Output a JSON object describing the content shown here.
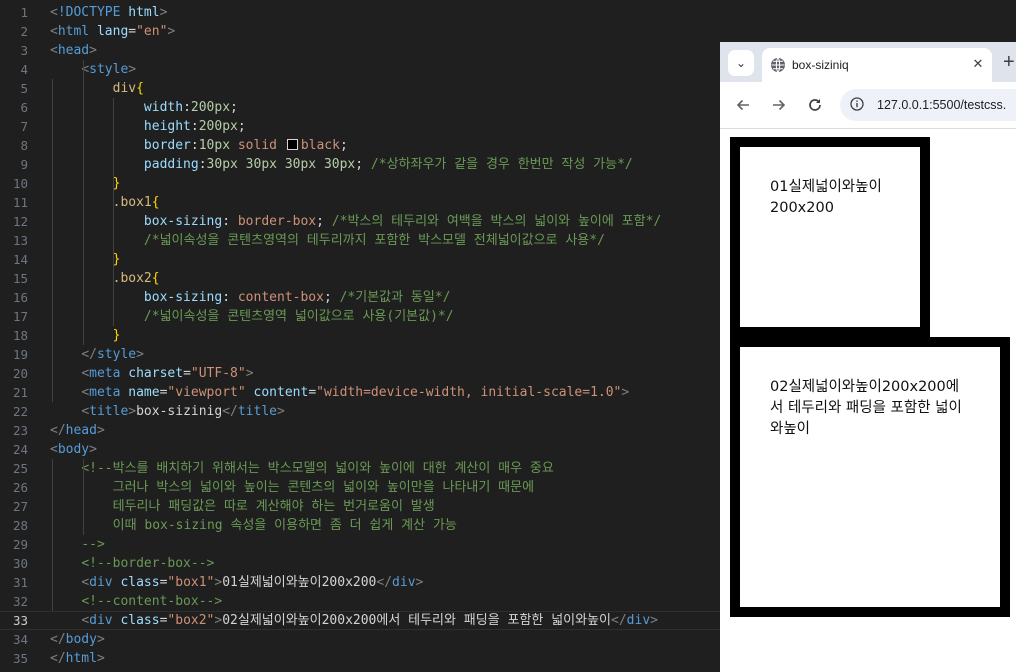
{
  "editor": {
    "lines": [
      {
        "n": "1",
        "segs": [
          [
            "t-tag",
            "<"
          ],
          [
            "t-dt",
            "!DOCTYPE "
          ],
          [
            "t-an",
            "html"
          ],
          [
            "t-tag",
            ">"
          ]
        ]
      },
      {
        "n": "2",
        "segs": [
          [
            "t-tag",
            "<"
          ],
          [
            "t-tn",
            "html "
          ],
          [
            "t-an",
            "lang"
          ],
          [
            "t-txt",
            "="
          ],
          [
            "t-av",
            "\"en\""
          ],
          [
            "t-tag",
            ">"
          ]
        ]
      },
      {
        "n": "3",
        "segs": [
          [
            "t-tag",
            "<"
          ],
          [
            "t-tn",
            "head"
          ],
          [
            "t-tag",
            ">"
          ]
        ]
      },
      {
        "n": "4",
        "segs": [
          [
            "t-txt",
            "    "
          ],
          [
            "t-tag",
            "<"
          ],
          [
            "t-tn",
            "style"
          ],
          [
            "t-tag",
            ">"
          ]
        ]
      },
      {
        "n": "5",
        "segs": [
          [
            "t-txt",
            "        "
          ],
          [
            "t-sel",
            "div"
          ],
          [
            "t-brace",
            "{"
          ]
        ]
      },
      {
        "n": "6",
        "segs": [
          [
            "t-txt",
            "            "
          ],
          [
            "t-prop",
            "width"
          ],
          [
            "t-txt",
            ":"
          ],
          [
            "t-num",
            "200px"
          ],
          [
            "t-txt",
            ";"
          ]
        ]
      },
      {
        "n": "7",
        "segs": [
          [
            "t-txt",
            "            "
          ],
          [
            "t-prop",
            "height"
          ],
          [
            "t-txt",
            ":"
          ],
          [
            "t-num",
            "200px"
          ],
          [
            "t-txt",
            ";"
          ]
        ]
      },
      {
        "n": "8",
        "segs": [
          [
            "t-txt",
            "            "
          ],
          [
            "t-prop",
            "border"
          ],
          [
            "t-txt",
            ":"
          ],
          [
            "t-num",
            "10px "
          ],
          [
            "t-val",
            "solid "
          ],
          [
            "swatch",
            ""
          ],
          [
            "t-val",
            "black"
          ],
          [
            "t-txt",
            ";"
          ]
        ]
      },
      {
        "n": "9",
        "segs": [
          [
            "t-txt",
            "            "
          ],
          [
            "t-prop",
            "padding"
          ],
          [
            "t-txt",
            ":"
          ],
          [
            "t-num",
            "30px 30px 30px 30px"
          ],
          [
            "t-txt",
            "; "
          ],
          [
            "t-com",
            "/*상하좌우가 같을 경우 한번만 작성 가능*/"
          ]
        ]
      },
      {
        "n": "10",
        "segs": [
          [
            "t-txt",
            "        "
          ],
          [
            "t-brace",
            "}"
          ]
        ]
      },
      {
        "n": "11",
        "segs": [
          [
            "t-txt",
            "        "
          ],
          [
            "t-sel",
            ".box1"
          ],
          [
            "t-brace",
            "{"
          ]
        ]
      },
      {
        "n": "12",
        "segs": [
          [
            "t-txt",
            "            "
          ],
          [
            "t-prop",
            "box-sizing"
          ],
          [
            "t-txt",
            ": "
          ],
          [
            "t-val",
            "border-box"
          ],
          [
            "t-txt",
            "; "
          ],
          [
            "t-com",
            "/*박스의 테두리와 여백을 박스의 넓이와 높이에 포함*/"
          ]
        ]
      },
      {
        "n": "13",
        "segs": [
          [
            "t-txt",
            "            "
          ],
          [
            "t-com",
            "/*넓이속성을 콘텐츠영역의 테두리까지 포함한 박스모델 전체넓이값으로 사용*/"
          ]
        ]
      },
      {
        "n": "14",
        "segs": [
          [
            "t-txt",
            "        "
          ],
          [
            "t-brace",
            "}"
          ]
        ]
      },
      {
        "n": "15",
        "segs": [
          [
            "t-txt",
            "        "
          ],
          [
            "t-sel",
            ".box2"
          ],
          [
            "t-brace",
            "{"
          ]
        ]
      },
      {
        "n": "16",
        "segs": [
          [
            "t-txt",
            "            "
          ],
          [
            "t-prop",
            "box-sizing"
          ],
          [
            "t-txt",
            ": "
          ],
          [
            "t-val",
            "content-box"
          ],
          [
            "t-txt",
            "; "
          ],
          [
            "t-com",
            "/*기본값과 동일*/"
          ]
        ]
      },
      {
        "n": "17",
        "segs": [
          [
            "t-txt",
            "            "
          ],
          [
            "t-com",
            "/*넓이속성을 콘텐츠영역 넓이값으로 사용(기본값)*/"
          ]
        ]
      },
      {
        "n": "18",
        "segs": [
          [
            "t-txt",
            "        "
          ],
          [
            "t-brace",
            "}"
          ]
        ]
      },
      {
        "n": "19",
        "segs": [
          [
            "t-txt",
            "    "
          ],
          [
            "t-tag",
            "</"
          ],
          [
            "t-tn",
            "style"
          ],
          [
            "t-tag",
            ">"
          ]
        ]
      },
      {
        "n": "20",
        "segs": [
          [
            "t-txt",
            "    "
          ],
          [
            "t-tag",
            "<"
          ],
          [
            "t-tn",
            "meta "
          ],
          [
            "t-an",
            "charset"
          ],
          [
            "t-txt",
            "="
          ],
          [
            "t-av",
            "\"UTF-8\""
          ],
          [
            "t-tag",
            ">"
          ]
        ]
      },
      {
        "n": "21",
        "segs": [
          [
            "t-txt",
            "    "
          ],
          [
            "t-tag",
            "<"
          ],
          [
            "t-tn",
            "meta "
          ],
          [
            "t-an",
            "name"
          ],
          [
            "t-txt",
            "="
          ],
          [
            "t-av",
            "\"viewport\" "
          ],
          [
            "t-an",
            "content"
          ],
          [
            "t-txt",
            "="
          ],
          [
            "t-av",
            "\"width=device-width, initial-scale=1.0\""
          ],
          [
            "t-tag",
            ">"
          ]
        ]
      },
      {
        "n": "22",
        "segs": [
          [
            "t-txt",
            "    "
          ],
          [
            "t-tag",
            "<"
          ],
          [
            "t-tn",
            "title"
          ],
          [
            "t-tag",
            ">"
          ],
          [
            "t-txt",
            "box-sizinig"
          ],
          [
            "t-tag",
            "</"
          ],
          [
            "t-tn",
            "title"
          ],
          [
            "t-tag",
            ">"
          ]
        ]
      },
      {
        "n": "23",
        "segs": [
          [
            "t-tag",
            "</"
          ],
          [
            "t-tn",
            "head"
          ],
          [
            "t-tag",
            ">"
          ]
        ]
      },
      {
        "n": "24",
        "segs": [
          [
            "t-tag",
            "<"
          ],
          [
            "t-tn",
            "body"
          ],
          [
            "t-tag",
            ">"
          ]
        ]
      },
      {
        "n": "25",
        "segs": [
          [
            "t-txt",
            "    "
          ],
          [
            "t-com",
            "<!--박스를 배치하기 위해서는 박스모델의 넓이와 높이에 대한 계산이 매우 중요"
          ]
        ]
      },
      {
        "n": "26",
        "segs": [
          [
            "t-txt",
            "        "
          ],
          [
            "t-com",
            "그러나 박스의 넓이와 높이는 콘텐츠의 넓이와 높이만을 나타내기 때문에"
          ]
        ]
      },
      {
        "n": "27",
        "segs": [
          [
            "t-txt",
            "        "
          ],
          [
            "t-com",
            "테두리나 패딩값은 따로 계산해야 하는 번거로움이 발생"
          ]
        ]
      },
      {
        "n": "28",
        "segs": [
          [
            "t-txt",
            "        "
          ],
          [
            "t-com",
            "이때 box-sizing 속성을 이용하면 좀 더 쉽게 계산 가능"
          ]
        ]
      },
      {
        "n": "29",
        "segs": [
          [
            "t-txt",
            "    "
          ],
          [
            "t-com",
            "-->"
          ]
        ]
      },
      {
        "n": "30",
        "segs": [
          [
            "t-txt",
            "    "
          ],
          [
            "t-com",
            "<!--border-box-->"
          ]
        ]
      },
      {
        "n": "31",
        "segs": [
          [
            "t-txt",
            "    "
          ],
          [
            "t-tag",
            "<"
          ],
          [
            "t-tn",
            "div "
          ],
          [
            "t-an",
            "class"
          ],
          [
            "t-txt",
            "="
          ],
          [
            "t-av",
            "\"box1\""
          ],
          [
            "t-tag",
            ">"
          ],
          [
            "t-txt",
            "01실제넓이와높이200x200"
          ],
          [
            "t-tag",
            "</"
          ],
          [
            "t-tn",
            "div"
          ],
          [
            "t-tag",
            ">"
          ]
        ]
      },
      {
        "n": "32",
        "segs": [
          [
            "t-txt",
            "    "
          ],
          [
            "t-com",
            "<!--content-box-->"
          ]
        ]
      },
      {
        "n": "33",
        "segs": [
          [
            "t-txt",
            "    "
          ],
          [
            "t-tag",
            "<"
          ],
          [
            "t-tn",
            "div "
          ],
          [
            "t-an",
            "class"
          ],
          [
            "t-txt",
            "="
          ],
          [
            "t-av",
            "\"box2\""
          ],
          [
            "t-tag",
            ">"
          ],
          [
            "t-txt",
            "02실제넓이와높이200x200에서 테두리와 패딩을 포함한 넓이와높이"
          ],
          [
            "t-tag",
            "</"
          ],
          [
            "t-tn",
            "div"
          ],
          [
            "t-tag",
            ">"
          ]
        ]
      },
      {
        "n": "34",
        "segs": [
          [
            "t-tag",
            "</"
          ],
          [
            "t-tn",
            "body"
          ],
          [
            "t-tag",
            ">"
          ]
        ]
      },
      {
        "n": "35",
        "segs": [
          [
            "t-tag",
            "</"
          ],
          [
            "t-tn",
            "html"
          ],
          [
            "t-tag",
            ">"
          ]
        ]
      }
    ],
    "current_line": "33"
  },
  "browser": {
    "tab_title": "box-siziniq",
    "tab_close_glyph": "✕",
    "new_tab_glyph": "+",
    "tab_list_glyph": "⌄",
    "url": "127.0.0.1:5500/testcss.",
    "page": {
      "box1_text": "01실제넓이와높이200x200",
      "box2_text": "02실제넓이와높이200x200에서 테두리와 패딩을 포함한 넓이와높이"
    }
  }
}
